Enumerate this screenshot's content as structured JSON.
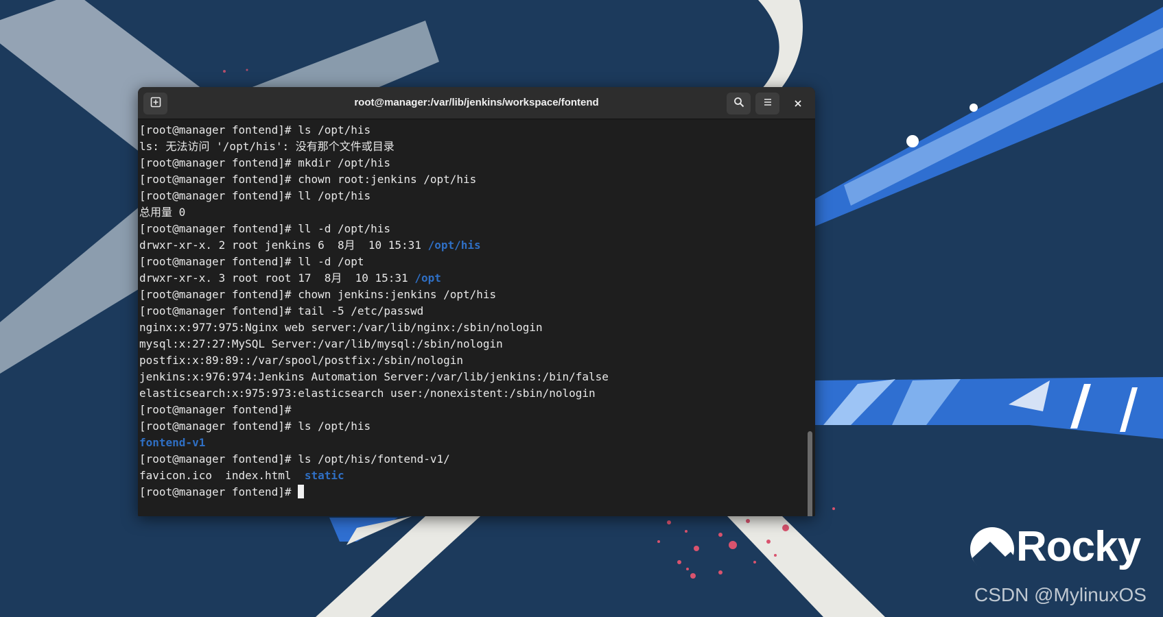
{
  "window": {
    "title": "root@manager:/var/lib/jenkins/workspace/fontend",
    "new_tab_icon": "new-tab-icon",
    "search_icon": "search-icon",
    "menu_icon": "hamburger-menu-icon",
    "close_icon": "close-icon"
  },
  "terminal": {
    "lines": [
      [
        {
          "t": "[root@manager fontend]# ls /opt/his"
        }
      ],
      [
        {
          "t": "ls: 无法访问 '/opt/his': 没有那个文件或目录"
        }
      ],
      [
        {
          "t": "[root@manager fontend]# mkdir /opt/his"
        }
      ],
      [
        {
          "t": "[root@manager fontend]# chown root:jenkins /opt/his"
        }
      ],
      [
        {
          "t": "[root@manager fontend]# ll /opt/his"
        }
      ],
      [
        {
          "t": "总用量 0"
        }
      ],
      [
        {
          "t": "[root@manager fontend]# ll -d /opt/his"
        }
      ],
      [
        {
          "t": "drwxr-xr-x. 2 root jenkins 6  8月  10 15:31 "
        },
        {
          "t": "/opt/his",
          "c": "dir"
        }
      ],
      [
        {
          "t": "[root@manager fontend]# ll -d /opt"
        }
      ],
      [
        {
          "t": "drwxr-xr-x. 3 root root 17  8月  10 15:31 "
        },
        {
          "t": "/opt",
          "c": "dir"
        }
      ],
      [
        {
          "t": "[root@manager fontend]# chown jenkins:jenkins /opt/his"
        }
      ],
      [
        {
          "t": "[root@manager fontend]# tail -5 /etc/passwd"
        }
      ],
      [
        {
          "t": "nginx:x:977:975:Nginx web server:/var/lib/nginx:/sbin/nologin"
        }
      ],
      [
        {
          "t": "mysql:x:27:27:MySQL Server:/var/lib/mysql:/sbin/nologin"
        }
      ],
      [
        {
          "t": "postfix:x:89:89::/var/spool/postfix:/sbin/nologin"
        }
      ],
      [
        {
          "t": "jenkins:x:976:974:Jenkins Automation Server:/var/lib/jenkins:/bin/false"
        }
      ],
      [
        {
          "t": "elasticsearch:x:975:973:elasticsearch user:/nonexistent:/sbin/nologin"
        }
      ],
      [
        {
          "t": "[root@manager fontend]#"
        }
      ],
      [
        {
          "t": "[root@manager fontend]# ls /opt/his"
        }
      ],
      [
        {
          "t": "fontend-v1",
          "c": "dir"
        }
      ],
      [
        {
          "t": "[root@manager fontend]# ls /opt/his/fontend-v1/"
        }
      ],
      [
        {
          "t": "favicon.ico  index.html  "
        },
        {
          "t": "static",
          "c": "dir"
        }
      ],
      [
        {
          "t": "[root@manager fontend]# "
        },
        {
          "cursor": true
        }
      ]
    ]
  },
  "colors": {
    "desktop_bg": "#1c3a5c",
    "terminal_bg": "#1e1e1e",
    "titlebar_bg": "#2d2d2d",
    "directory_text": "#2f6fc4",
    "terminal_text": "#e8e8e8"
  },
  "branding": {
    "logo_text": "Rocky",
    "watermark": "CSDN @MylinuxOS"
  }
}
